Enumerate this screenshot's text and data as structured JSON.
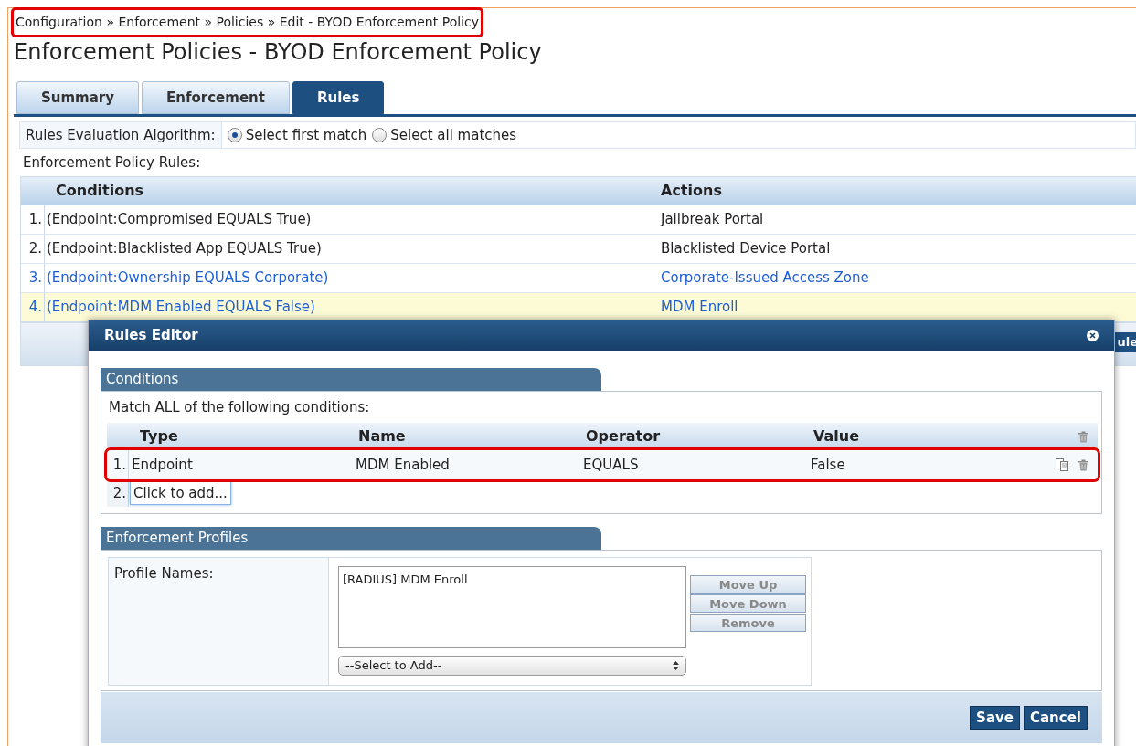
{
  "breadcrumb": {
    "text": "Configuration » Enforcement » Policies » Edit - BYOD Enforcement Policy",
    "highlighted": true
  },
  "page_title": "Enforcement Policies - BYOD Enforcement Policy",
  "tabs": [
    {
      "label": "Summary",
      "selected": false
    },
    {
      "label": "Enforcement",
      "selected": false
    },
    {
      "label": "Rules",
      "selected": true
    }
  ],
  "algorithm": {
    "label": "Rules Evaluation Algorithm:",
    "options": [
      {
        "label": "Select first match",
        "selected": true
      },
      {
        "label": "Select all matches",
        "selected": false
      }
    ]
  },
  "rules_label": "Enforcement Policy Rules:",
  "rules_table": {
    "columns": [
      "Conditions",
      "Actions"
    ],
    "rows": [
      {
        "number": "1.",
        "condition": "(Endpoint:Compromised EQUALS True)",
        "action": "Jailbreak Portal",
        "kind": "plain",
        "selected": false
      },
      {
        "number": "2.",
        "condition": "(Endpoint:Blacklisted App EQUALS True)",
        "action": "Blacklisted Device Portal",
        "kind": "plain",
        "selected": false
      },
      {
        "number": "3.",
        "condition": "(Endpoint:Ownership EQUALS Corporate)",
        "action": "Corporate-Issued Access Zone",
        "kind": "link",
        "selected": false
      },
      {
        "number": "4.",
        "condition": "(Endpoint:MDM Enabled EQUALS False)",
        "action": "MDM Enroll",
        "kind": "link",
        "selected": true
      }
    ]
  },
  "hidden_button": "ule",
  "dialog": {
    "title": "Rules Editor",
    "conditions": {
      "title": "Conditions",
      "intro": "Match ALL of the following conditions:",
      "columns": [
        "Type",
        "Name",
        "Operator",
        "Value"
      ],
      "rows": [
        {
          "number": "1.",
          "type": "Endpoint",
          "name": "MDM Enabled",
          "operator": "EQUALS",
          "value": "False",
          "highlighted": true
        }
      ],
      "add_row": {
        "number": "2.",
        "label": "Click to add..."
      }
    },
    "profiles": {
      "title": "Enforcement Profiles",
      "label": "Profile Names:",
      "items": [
        "[RADIUS] MDM Enroll"
      ],
      "select": "--Select to Add--",
      "buttons": [
        "Move Up",
        "Move Down",
        "Remove"
      ]
    },
    "buttons": [
      "Save",
      "Cancel"
    ]
  }
}
